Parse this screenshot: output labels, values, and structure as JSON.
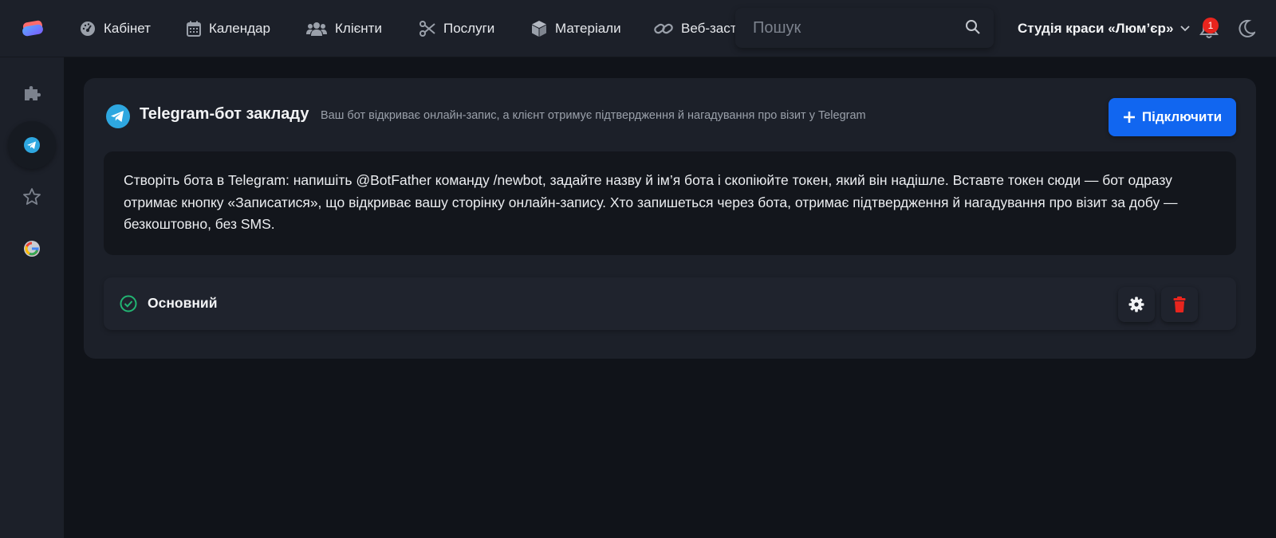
{
  "colors": {
    "accent": "#1166f0",
    "danger": "#e8251e",
    "success": "#22b573",
    "telegram": "#2ea7e0"
  },
  "nav": {
    "items": [
      {
        "label": "Кабінет",
        "icon": "dashboard-icon"
      },
      {
        "label": "Календар",
        "icon": "calendar-icon"
      },
      {
        "label": "Клієнти",
        "icon": "users-icon"
      },
      {
        "label": "Послуги",
        "icon": "scissors-icon"
      },
      {
        "label": "Матеріали",
        "icon": "cube-icon"
      },
      {
        "label": "Веб-застосунок",
        "icon": "link-icon"
      }
    ]
  },
  "search": {
    "placeholder": "Пошук"
  },
  "studio": {
    "name": "Студія краси «Люм’єр»"
  },
  "notifications": {
    "count": "1"
  },
  "sidebar": {
    "items": [
      {
        "name": "integrations",
        "icon": "puzzle-icon"
      },
      {
        "name": "telegram",
        "icon": "telegram-icon",
        "active": true
      },
      {
        "name": "reviews",
        "icon": "star-icon"
      },
      {
        "name": "google",
        "icon": "google-icon"
      }
    ]
  },
  "card": {
    "title": "Telegram-бот закладу",
    "subtitle": "Ваш бот відкриває онлайн-запис, а клієнт отримує підтвердження й нагадування про візит у Telegram",
    "connect_label": "Підключити",
    "info": "Створіть бота в Telegram: напишіть @BotFather команду /newbot, задайте назву й ім’я бота і скопіюйте токен, який він надішле. Вставте токен сюди — бот одразу отримає кнопку «Записатися», що відкриває вашу сторінку онлайн-запису. Хто запишеться через бота, отримає підтвердження й нагадування про візит за добу — безкоштовно, без SMS."
  },
  "bots": [
    {
      "name": "Основний",
      "status": "active"
    }
  ]
}
